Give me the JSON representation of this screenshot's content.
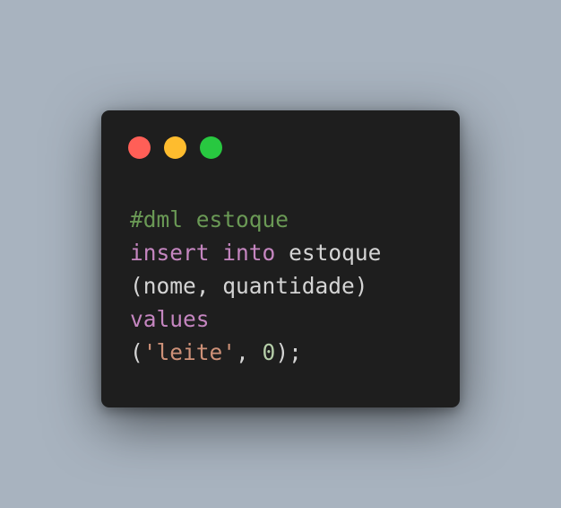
{
  "window": {
    "buttons": [
      {
        "name": "close",
        "color": "#ff5f57"
      },
      {
        "name": "minimize",
        "color": "#febc2e"
      },
      {
        "name": "maximize",
        "color": "#28c840"
      }
    ]
  },
  "colors": {
    "background": "#a8b3bf",
    "window": "#1e1e1e",
    "comment": "#6a9955",
    "keyword": "#c586c0",
    "text": "#d4d4d4",
    "string": "#ce9178",
    "number": "#b5cea8"
  },
  "code": {
    "comment": "#dml estoque",
    "insert_kw": "insert",
    "into_kw": "into",
    "table": "estoque",
    "columns": "(nome, quantidade)",
    "values_kw": "values",
    "open_paren": "(",
    "string_val": "'leite'",
    "comma": ", ",
    "number_val": "0",
    "close": ");"
  }
}
